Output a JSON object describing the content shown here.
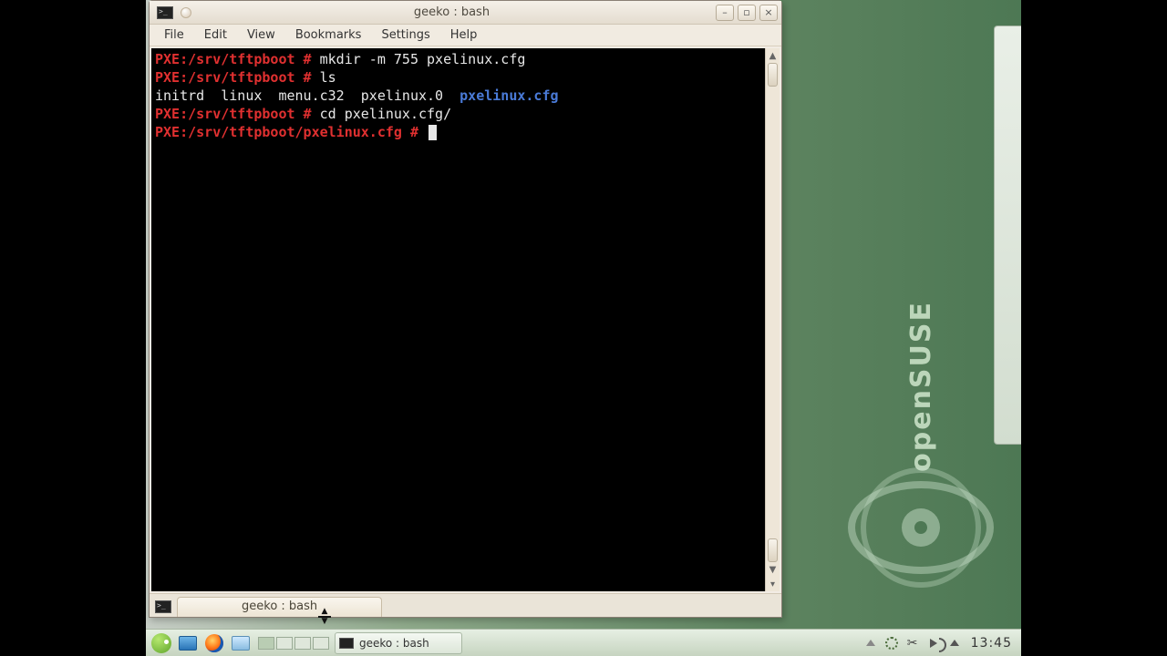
{
  "window": {
    "title": "geeko : bash",
    "menus": {
      "file": "File",
      "edit": "Edit",
      "view": "View",
      "bookmarks": "Bookmarks",
      "settings": "Settings",
      "help": "Help"
    },
    "tab_label": "geeko : bash"
  },
  "terminal": {
    "lines": [
      {
        "prompt": "PXE:/srv/tftpboot #",
        "cmd": "mkdir -m 755 pxelinux.cfg"
      },
      {
        "prompt": "PXE:/srv/tftpboot #",
        "cmd": "ls"
      },
      {
        "output_plain": "initrd  linux  menu.c32  pxelinux.0  ",
        "output_dir": "pxelinux.cfg"
      },
      {
        "prompt": "PXE:/srv/tftpboot #",
        "cmd": "cd pxelinux.cfg/"
      },
      {
        "prompt": "PXE:/srv/tftpboot/pxelinux.cfg #",
        "cmd": "",
        "cursor": true
      }
    ]
  },
  "taskbar": {
    "task_label": "geeko : bash",
    "clock": "13:45"
  },
  "wallpaper": {
    "brand": "openSUSE"
  }
}
